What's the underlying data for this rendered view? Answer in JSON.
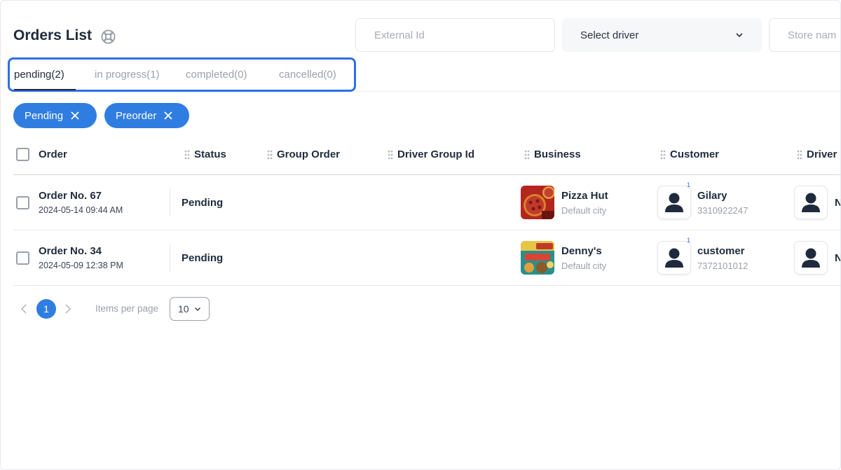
{
  "header": {
    "title": "Orders List",
    "help_icon": "lifebuoy-icon"
  },
  "filters": {
    "external_id_placeholder": "External Id",
    "driver_select_label": "Select driver",
    "store_name_placeholder": "Store nam"
  },
  "tabs": [
    {
      "label": "pending(2)",
      "active": true
    },
    {
      "label": "in progress(1)",
      "active": false
    },
    {
      "label": "completed(0)",
      "active": false
    },
    {
      "label": "cancelled(0)",
      "active": false
    }
  ],
  "highlight_color": "#2f6fe4",
  "chips": [
    {
      "label": "Pending"
    },
    {
      "label": "Preorder"
    }
  ],
  "table": {
    "columns": [
      "Order",
      "Status",
      "Group Order",
      "Driver Group Id",
      "Business",
      "Customer",
      "Driver"
    ],
    "rows": [
      {
        "order_no": "Order No. 67",
        "date": "2024-05-14 09:44 AM",
        "status": "Pending",
        "business": {
          "name": "Pizza Hut",
          "city": "Default city"
        },
        "customer": {
          "name": "Gilary",
          "phone": "3310922247",
          "badge": "1"
        },
        "driver_initial": "N"
      },
      {
        "order_no": "Order No. 34",
        "date": "2024-05-09 12:38 PM",
        "status": "Pending",
        "business": {
          "name": "Denny's",
          "city": "Default city"
        },
        "customer": {
          "name": "customer",
          "phone": "7372101012",
          "badge": "1"
        },
        "driver_initial": "N"
      }
    ]
  },
  "pagination": {
    "current_page": "1",
    "items_per_page_label": "Items per page",
    "items_per_page_value": "10"
  },
  "colors": {
    "accent": "#2f7de1",
    "text": "#1f2b3d",
    "muted": "#9aa1ab"
  }
}
